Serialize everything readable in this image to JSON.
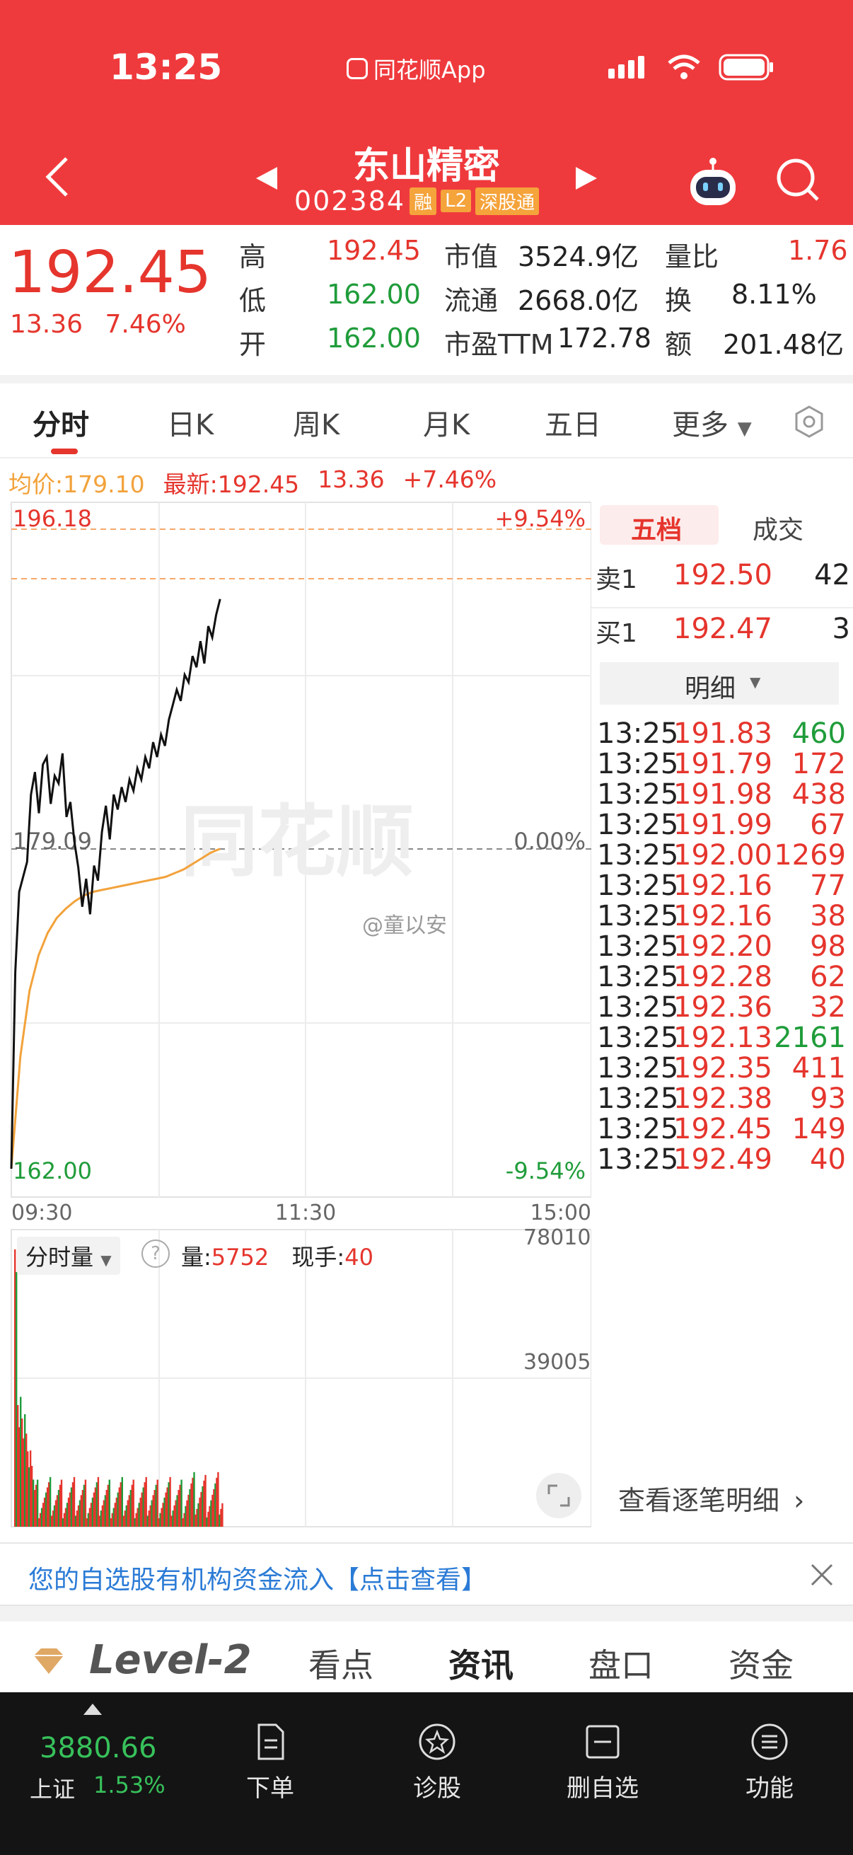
{
  "status_bar": {
    "time": "13:25",
    "app_name": "同花顺App"
  },
  "header": {
    "stock_name": "东山精密",
    "stock_code": "002384",
    "tags": [
      "融",
      "L2",
      "深股通"
    ]
  },
  "quote": {
    "price": "192.45",
    "change": "13.36",
    "change_pct": "7.46%",
    "fields": [
      {
        "label": "高",
        "value": "192.45"
      },
      {
        "label": "低",
        "value": "162.00"
      },
      {
        "label": "开",
        "value": "162.00"
      },
      {
        "label": "市值",
        "value": "3524.9亿"
      },
      {
        "label": "流通",
        "value": "2668.0亿"
      },
      {
        "label": "市盈TTM",
        "value": "172.78"
      },
      {
        "label": "量比",
        "value": "1.76"
      },
      {
        "label": "换",
        "value": "8.11%"
      },
      {
        "label": "额",
        "value": "201.48亿"
      }
    ]
  },
  "tabs": [
    "分时",
    "日K",
    "周K",
    "月K",
    "五日",
    "更多"
  ],
  "info_row": {
    "avg": "均价:179.10",
    "latest": "最新:192.45",
    "change": "13.36",
    "change_pct": "+7.46%"
  },
  "chart": {
    "upper": "196.18",
    "upper_pct": "+9.54%",
    "mid": "179.09",
    "mid_pct": "0.00%",
    "lower": "162.00",
    "lower_pct": "-9.54%",
    "times": [
      "09:30",
      "11:30",
      "15:00"
    ],
    "watermark": "同花顺",
    "credit": "@童以安"
  },
  "chart_data": {
    "type": "line",
    "ylim": [
      162.0,
      196.18
    ],
    "reference_price": 179.09,
    "x_labels": [
      "09:30",
      "11:30",
      "15:00"
    ],
    "series": [
      {
        "name": "最新",
        "values": [
          162.0,
          172.5,
          176.8,
          177.6,
          178.4,
          182.0,
          183.2,
          181.0,
          183.6,
          184.0,
          181.5,
          183.0,
          182.6,
          184.2,
          180.8,
          181.6,
          179.5,
          178.1,
          176.0,
          177.5,
          175.6,
          178.2,
          177.4,
          180.0,
          181.4,
          179.6,
          182.0,
          181.2,
          182.4,
          181.6,
          182.8,
          182.2,
          183.4,
          182.8,
          184.0,
          183.4,
          184.8,
          184.0,
          185.2,
          184.6,
          186.0,
          186.8,
          187.6,
          187.0,
          188.4,
          188.0,
          189.4,
          188.8,
          190.2,
          189.0,
          191.0,
          190.4,
          191.6,
          192.45
        ]
      },
      {
        "name": "均价",
        "values": [
          162.0,
          168.0,
          171.5,
          173.4,
          174.6,
          175.4,
          175.9,
          176.3,
          176.6,
          176.8,
          176.9,
          177.0,
          177.1,
          177.2,
          177.3,
          177.4,
          177.5,
          177.6,
          177.8,
          178.0,
          178.3,
          178.6,
          178.9,
          179.1
        ]
      }
    ],
    "volume": {
      "max_label": "78010",
      "mid_label": "39005",
      "current": "5752",
      "hand": "40"
    }
  },
  "volume_panel": {
    "selector": "分时量",
    "vol_label": "量:",
    "vol_value": "5752",
    "hand_label": "现手:",
    "hand_value": "40",
    "top_tick": "78010",
    "mid_tick": "39005"
  },
  "order_book": {
    "tabs": [
      "五档",
      "成交"
    ],
    "sell1": {
      "label": "卖1",
      "price": "192.50",
      "qty": "42"
    },
    "buy1": {
      "label": "买1",
      "price": "192.47",
      "qty": "3"
    },
    "detail_header": "明细",
    "details": [
      {
        "time": "13:25",
        "price": "191.83",
        "qty": "460",
        "dir": "sell"
      },
      {
        "time": "13:25",
        "price": "191.79",
        "qty": "172",
        "dir": "buy"
      },
      {
        "time": "13:25",
        "price": "191.98",
        "qty": "438",
        "dir": "buy"
      },
      {
        "time": "13:25",
        "price": "191.99",
        "qty": "67",
        "dir": "buy"
      },
      {
        "time": "13:25",
        "price": "192.00",
        "qty": "1269",
        "dir": "buy"
      },
      {
        "time": "13:25",
        "price": "192.16",
        "qty": "77",
        "dir": "buy"
      },
      {
        "time": "13:25",
        "price": "192.16",
        "qty": "38",
        "dir": "buy"
      },
      {
        "time": "13:25",
        "price": "192.20",
        "qty": "98",
        "dir": "buy"
      },
      {
        "time": "13:25",
        "price": "192.28",
        "qty": "62",
        "dir": "buy"
      },
      {
        "time": "13:25",
        "price": "192.36",
        "qty": "32",
        "dir": "buy"
      },
      {
        "time": "13:25",
        "price": "192.13",
        "qty": "2161",
        "dir": "sell"
      },
      {
        "time": "13:25",
        "price": "192.35",
        "qty": "411",
        "dir": "buy"
      },
      {
        "time": "13:25",
        "price": "192.38",
        "qty": "93",
        "dir": "buy"
      },
      {
        "time": "13:25",
        "price": "192.45",
        "qty": "149",
        "dir": "buy"
      },
      {
        "time": "13:25",
        "price": "192.49",
        "qty": "40",
        "dir": "buy"
      }
    ],
    "more_link": "查看逐笔明细"
  },
  "notice": {
    "text": "您的自选股有机构资金流入【点击查看】"
  },
  "l2_bar": {
    "brand": "Level-2",
    "tabs": [
      "看点",
      "资讯",
      "盘口",
      "资金"
    ]
  },
  "bottom_nav": {
    "index_value": "3880.66",
    "index_name": "上证",
    "index_pct": "1.53%",
    "items": [
      "下单",
      "诊股",
      "删自选",
      "功能"
    ]
  },
  "colors": {
    "brand_red": "#ef3a3d",
    "up": "#e5352d",
    "down": "#1f9c3a",
    "avg_line": "#f2a23b"
  }
}
